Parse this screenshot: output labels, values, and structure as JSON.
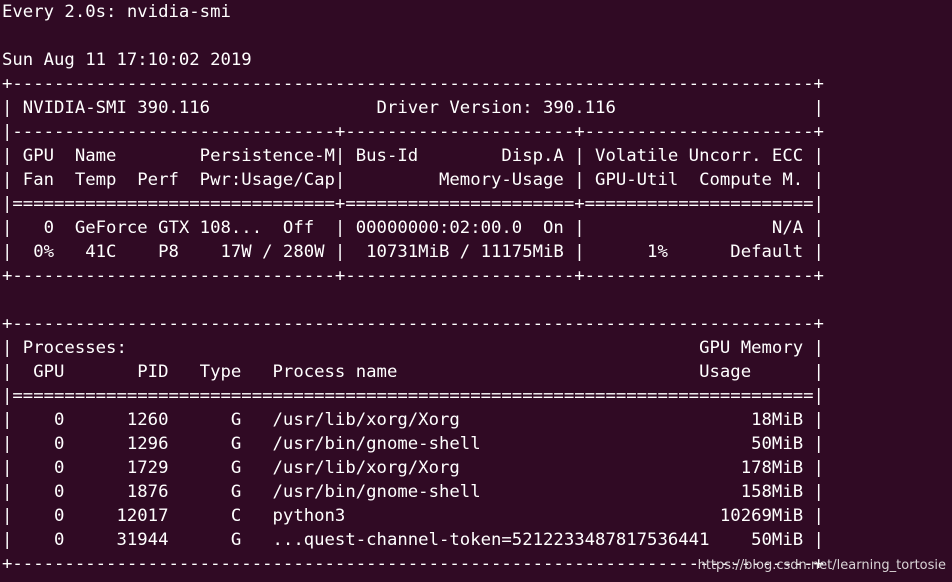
{
  "terminal": {
    "header": "Every 2.0s: nvidia-smi",
    "timestamp": "Sun Aug 11 17:10:02 2019",
    "gpu_table": [
      "+-----------------------------------------------------------------------------+",
      "| NVIDIA-SMI 390.116                Driver Version: 390.116                   |",
      "|-------------------------------+----------------------+----------------------+",
      "| GPU  Name        Persistence-M| Bus-Id        Disp.A | Volatile Uncorr. ECC |",
      "| Fan  Temp  Perf  Pwr:Usage/Cap|         Memory-Usage | GPU-Util  Compute M. |",
      "|===============================+======================+======================|",
      "|   0  GeForce GTX 108...  Off  | 00000000:02:00.0  On |                  N/A |",
      "|  0%   41C    P8    17W / 280W |  10731MiB / 11175MiB |      1%      Default |",
      "+-------------------------------+----------------------+----------------------+"
    ],
    "process_table": [
      "+-----------------------------------------------------------------------------+",
      "| Processes:                                                       GPU Memory |",
      "|  GPU       PID   Type   Process name                             Usage      |",
      "|=============================================================================|",
      "|    0      1260      G   /usr/lib/xorg/Xorg                            18MiB |",
      "|    0      1296      G   /usr/bin/gnome-shell                          50MiB |",
      "|    0      1729      G   /usr/lib/xorg/Xorg                           178MiB |",
      "|    0      1876      G   /usr/bin/gnome-shell                         158MiB |",
      "|    0     12017      C   python3                                    10269MiB |",
      "|    0     31944      G   ...quest-channel-token=5212233487817536441    50MiB |",
      "+-----------------------------------------------------------------------------+"
    ]
  },
  "watermark": "https://blog.csdn.net/learning_tortosie"
}
